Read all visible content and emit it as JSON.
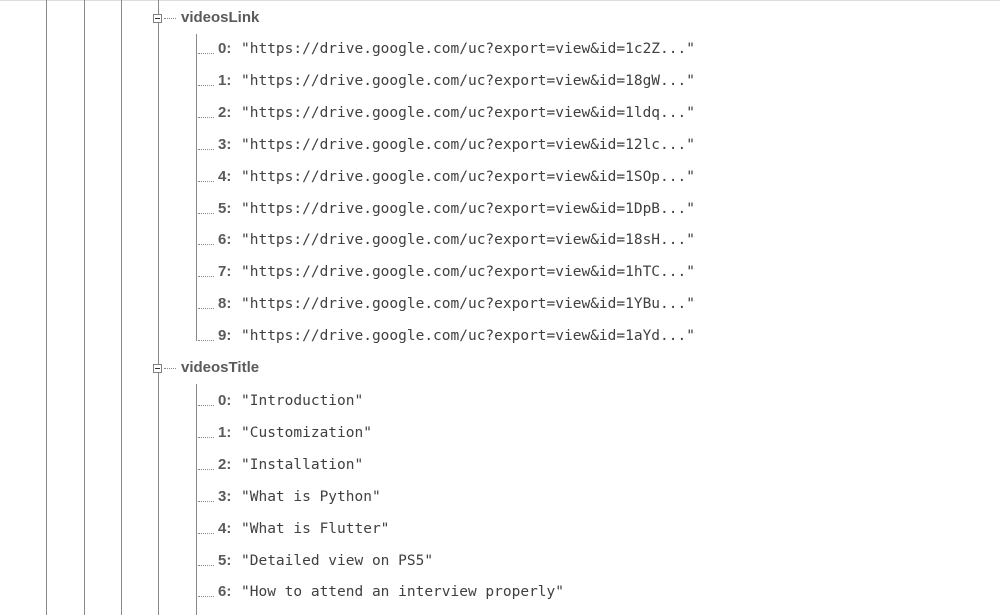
{
  "tree": {
    "videosLink": {
      "key": "videosLink",
      "children": [
        {
          "key": "0:",
          "value": "\"https://drive.google.com/uc?export=view&id=1c2Z...\""
        },
        {
          "key": "1:",
          "value": "\"https://drive.google.com/uc?export=view&id=18gW...\""
        },
        {
          "key": "2:",
          "value": "\"https://drive.google.com/uc?export=view&id=1ldq...\""
        },
        {
          "key": "3:",
          "value": "\"https://drive.google.com/uc?export=view&id=12lc...\""
        },
        {
          "key": "4:",
          "value": "\"https://drive.google.com/uc?export=view&id=1SOp...\""
        },
        {
          "key": "5:",
          "value": "\"https://drive.google.com/uc?export=view&id=1DpB...\""
        },
        {
          "key": "6:",
          "value": "\"https://drive.google.com/uc?export=view&id=18sH...\""
        },
        {
          "key": "7:",
          "value": "\"https://drive.google.com/uc?export=view&id=1hTC...\""
        },
        {
          "key": "8:",
          "value": "\"https://drive.google.com/uc?export=view&id=1YBu...\""
        },
        {
          "key": "9:",
          "value": "\"https://drive.google.com/uc?export=view&id=1aYd...\""
        }
      ]
    },
    "videosTitle": {
      "key": "videosTitle",
      "children": [
        {
          "key": "0:",
          "value": "\"Introduction\""
        },
        {
          "key": "1:",
          "value": "\"Customization\""
        },
        {
          "key": "2:",
          "value": "\"Installation\""
        },
        {
          "key": "3:",
          "value": "\"What is Python\""
        },
        {
          "key": "4:",
          "value": "\"What is Flutter\""
        },
        {
          "key": "5:",
          "value": "\"Detailed view on PS5\""
        },
        {
          "key": "6:",
          "value": "\"How to attend an interview properly\""
        }
      ]
    }
  }
}
